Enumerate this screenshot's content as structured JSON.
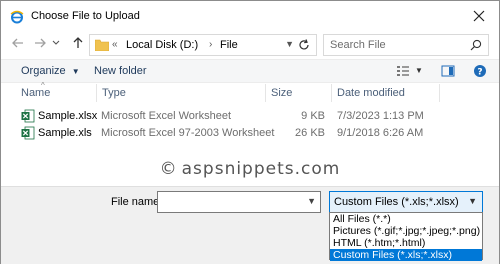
{
  "window": {
    "title": "Choose File to Upload"
  },
  "nav": {
    "address": {
      "chevron": "«",
      "segments": [
        "Local Disk (D:)",
        "File"
      ],
      "separator": "›"
    },
    "search_placeholder": "Search File"
  },
  "toolbar": {
    "organize_label": "Organize",
    "new_folder_label": "New folder"
  },
  "columns": {
    "name": "Name",
    "type": "Type",
    "size": "Size",
    "date": "Date modified"
  },
  "files": [
    {
      "name": "Sample.xlsx",
      "type": "Microsoft Excel Worksheet",
      "size": "9 KB",
      "date": "7/3/2023 1:13 PM"
    },
    {
      "name": "Sample.xls",
      "type": "Microsoft Excel 97-2003 Worksheet",
      "size": "26 KB",
      "date": "9/1/2018 6:26 AM"
    }
  ],
  "watermark": {
    "symbol": "©",
    "text": "aspsnippets.com"
  },
  "bottom": {
    "file_name_label": "File name:",
    "file_name_value": "",
    "file_type_selected": "Custom Files (*.xls;*.xlsx)",
    "file_type_options": [
      "All Files (*.*)",
      "Pictures (*.gif;*.jpg;*.jpeg;*.png)",
      "HTML (*.htm;*.html)",
      "Custom Files (*.xls;*.xlsx)"
    ]
  },
  "colors": {
    "accent": "#0078d7",
    "excel_green": "#1d7244",
    "folder_yellow": "#f0c24f"
  }
}
